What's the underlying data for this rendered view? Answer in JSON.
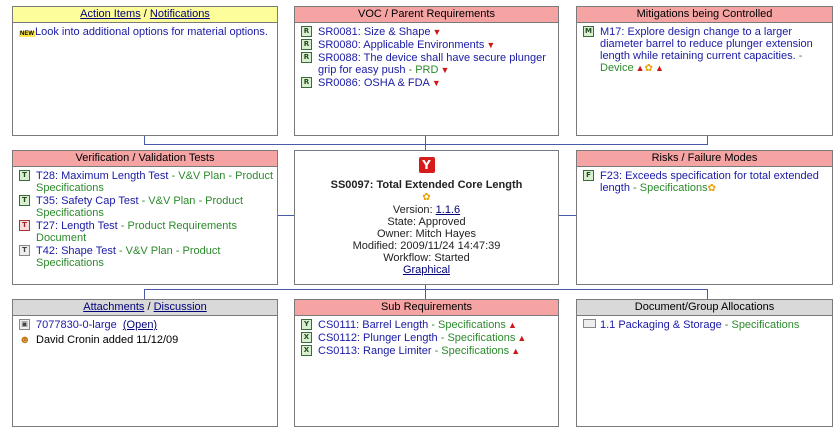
{
  "action_items": {
    "title_link1": "Action Items",
    "title_sep": "/",
    "title_link2": "Notifications",
    "items": [
      {
        "badge": "NEW",
        "text": "Look into additional options for material options."
      }
    ]
  },
  "voc": {
    "title": "VOC / Parent Requirements",
    "items": [
      {
        "text": "SR0081: Size & Shape",
        "suffix": ""
      },
      {
        "text": "SR0080: Applicable Environments",
        "suffix": ""
      },
      {
        "text": "SR0088: The device shall have secure plunger grip for easy push",
        "suffix": " - PRD"
      },
      {
        "text": "SR0086: OSHA & FDA",
        "suffix": ""
      }
    ]
  },
  "mitigations": {
    "title": "Mitigations being Controlled",
    "items": [
      {
        "text": "M17: Explore design change to a larger diameter barrel to reduce plunger extension length while retaining current capacities.",
        "suffix": " - Device"
      }
    ]
  },
  "verification": {
    "title": "Verification / Validation Tests",
    "items": [
      {
        "icon": "T",
        "text": "T28: Maximum Length Test",
        "suffix": " - V&V Plan - Product Specifications"
      },
      {
        "icon": "T",
        "text": "T35: Safety Cap Test",
        "suffix": " - V&V Plan - Product Specifications"
      },
      {
        "icon": "T",
        "text": "T27: Length Test",
        "suffix": " - Product Requirements Document"
      },
      {
        "icon": "T",
        "text": "T42: Shape Test",
        "suffix": " - V&V Plan - Product Specifications"
      }
    ]
  },
  "center": {
    "logo": "Y",
    "title": "SS0097: Total Extended Core Length",
    "version_label": "Version:",
    "version": "1.1.6",
    "state": "State: Approved",
    "owner": "Owner: Mitch Hayes",
    "modified": "Modified: 2009/11/24 14:47:39",
    "workflow": "Workflow: Started",
    "graphical": "Graphical"
  },
  "risks": {
    "title": "Risks / Failure Modes",
    "items": [
      {
        "icon": "F",
        "text": "F23: Exceeds specification for total extended length",
        "suffix": " - Specifications"
      }
    ]
  },
  "attachments": {
    "title_link1": "Attachments",
    "title_sep": "/",
    "title_link2": "Discussion",
    "file": "7077830-0-large",
    "open": "(Open)",
    "comment": "David Cronin added 11/12/09"
  },
  "subreq": {
    "title": "Sub Requirements",
    "items": [
      {
        "icon": "Y",
        "text": "CS0111: Barrel Length",
        "suffix": " - Specifications"
      },
      {
        "icon": "X",
        "text": "CS0112: Plunger Length",
        "suffix": " - Specifications"
      },
      {
        "icon": "X",
        "text": "CS0113: Range Limiter",
        "suffix": " - Specifications"
      }
    ]
  },
  "docalloc": {
    "title": "Document/Group Allocations",
    "items": [
      {
        "text": "1.1 Packaging & Storage",
        "suffix": " - Specifications"
      }
    ]
  }
}
